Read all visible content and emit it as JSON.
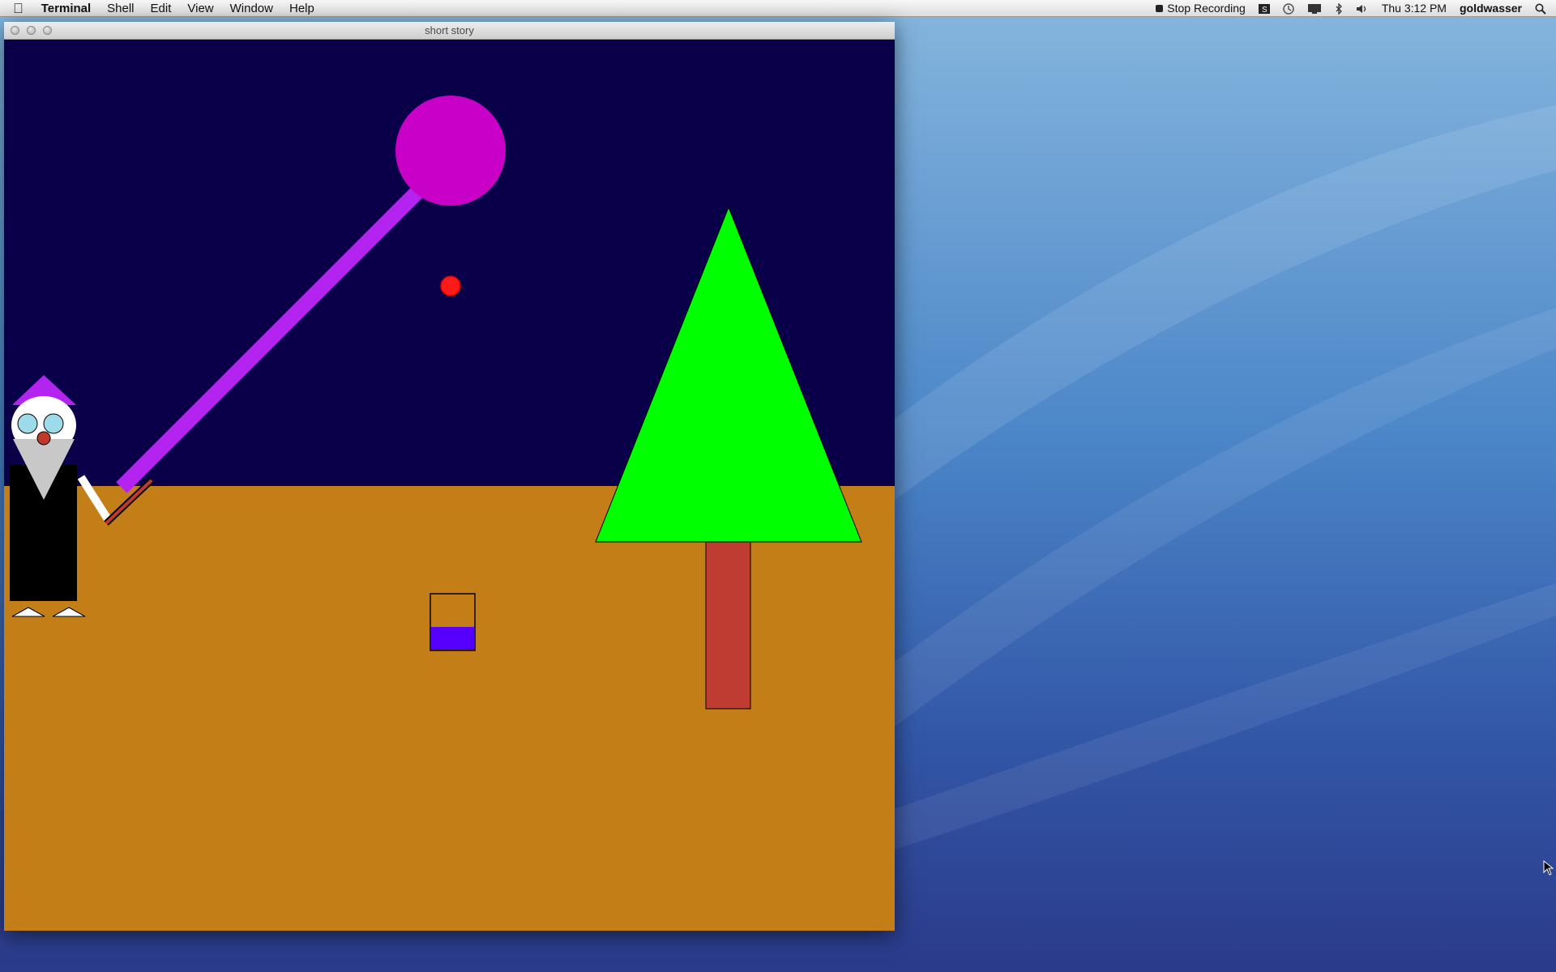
{
  "menubar": {
    "apple_icon": "apple-icon",
    "app_name": "Terminal",
    "menus": [
      "Shell",
      "Edit",
      "View",
      "Window",
      "Help"
    ],
    "status": {
      "stop_recording": "Stop Recording",
      "clock": "Thu 3:12 PM",
      "user": "goldwasser"
    }
  },
  "window": {
    "title": "short story"
  },
  "colors": {
    "sky": "#0a004a",
    "ground": "#c47e17",
    "moon": "#c800c8",
    "beam": "#b424f0",
    "tree_top": "#00ff00",
    "tree_trunk": "#bf3c32",
    "cauldron_liquid": "#5500ff",
    "red_spark": "#ff1a1a"
  }
}
